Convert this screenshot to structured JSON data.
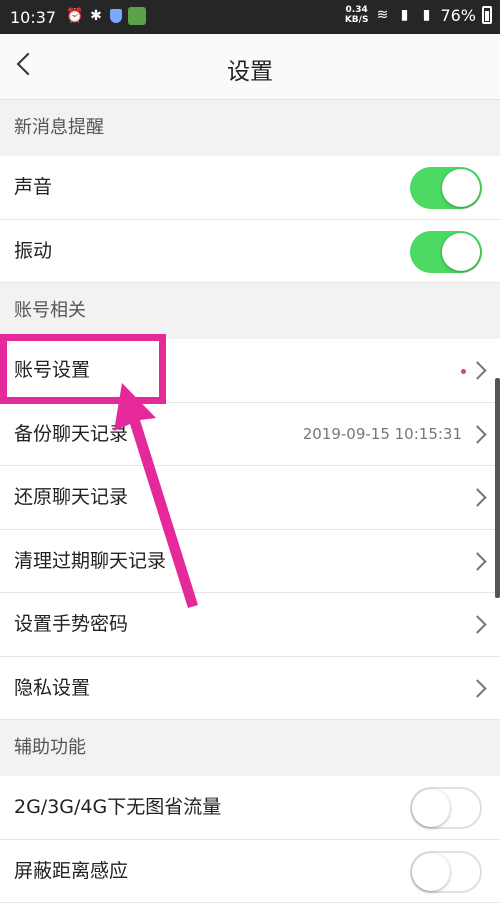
{
  "status_bar": {
    "time": "10:37",
    "net_speed_value": "0.34",
    "net_speed_unit": "KB/S",
    "battery": "76%"
  },
  "header": {
    "title": "设置"
  },
  "sections": [
    {
      "header": "新消息提醒"
    },
    {
      "header": "账号相关"
    },
    {
      "header": "辅助功能"
    }
  ],
  "rows": {
    "sound": {
      "label": "声音",
      "toggle": "on"
    },
    "vibrate": {
      "label": "振动",
      "toggle": "on"
    },
    "account_settings": {
      "label": "账号设置"
    },
    "backup_chat": {
      "label": "备份聊天记录",
      "value": "2019-09-15 10:15:31"
    },
    "restore_chat": {
      "label": "还原聊天记录"
    },
    "clean_chat": {
      "label": "清理过期聊天记录"
    },
    "gesture_password": {
      "label": "设置手势密码"
    },
    "privacy": {
      "label": "隐私设置"
    },
    "no_image_data": {
      "label": "2G/3G/4G下无图省流量",
      "toggle": "off"
    },
    "proximity": {
      "label": "屏蔽距离感应",
      "toggle": "off"
    }
  },
  "colors": {
    "toggle_on": "#4cd964",
    "annotation": "#e6299a"
  }
}
